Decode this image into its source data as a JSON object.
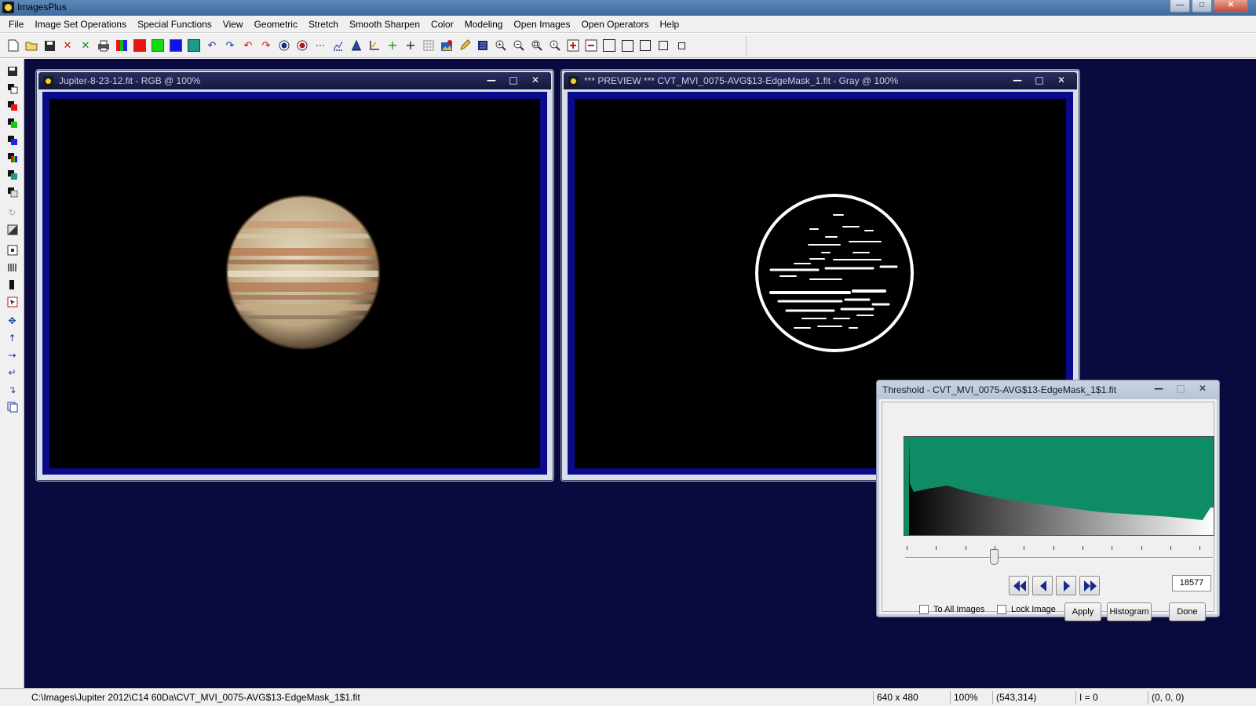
{
  "app": {
    "title": "ImagesPlus",
    "accent": "#0a0a3e"
  },
  "menu": [
    "File",
    "Image Set Operations",
    "Special Functions",
    "View",
    "Geometric",
    "Stretch",
    "Smooth Sharpen",
    "Color",
    "Modeling",
    "Open Images",
    "Open Operators",
    "Help"
  ],
  "toolbar": {
    "icons": [
      "new-file-icon",
      "open-folder-icon",
      "save-icon",
      "close-x-icon",
      "close-all-x-icon",
      "print-icon",
      "rgb-channels-icon",
      "red-channel-icon",
      "green-channel-icon",
      "blue-channel-icon",
      "grid-icon",
      "undo-icon",
      "redo-icon",
      "undo-all-icon",
      "redo-all-icon",
      "circle-mask-icon",
      "red-circle-icon",
      "dotted-line-icon",
      "plot-icon",
      "triangle-icon",
      "corner-icon",
      "plus-green-icon",
      "crosshair-icon",
      "grid-small-icon",
      "picture-edit-icon",
      "pencil-icon",
      "list-icon",
      "zoom-in-icon",
      "zoom-out-icon",
      "zoom-fit-icon",
      "zoom-actual-icon",
      "zoom-in-red-icon",
      "zoom-out-red-icon",
      "frame-large-icon",
      "frame-medium-icon",
      "frame-small-icon",
      "frame-smaller-icon",
      "frame-tiny-icon"
    ]
  },
  "windows": {
    "left": {
      "title": "Jupiter-8-23-12.fit - RGB @ 100%"
    },
    "right": {
      "title": "*** PREVIEW *** CVT_MVI_0075-AVG$13-EdgeMask_1.fit - Gray @ 100%"
    }
  },
  "threshold": {
    "title": "Threshold - CVT_MVI_0075-AVG$13-EdgeMask_1$1.fit",
    "value": "18577",
    "slider_fraction": 0.29,
    "histogram_color": "#0f8c66",
    "to_all_images": {
      "label": "To All Images",
      "checked": false
    },
    "lock_image": {
      "label": "Lock Image",
      "checked": false
    },
    "buttons": {
      "apply": "Apply",
      "histogram": "Histogram",
      "done": "Done"
    }
  },
  "status": {
    "path": "C:\\Images\\Jupiter 2012\\C14 60Da\\CVT_MVI_0075-AVG$13-EdgeMask_1$1.fit",
    "size": "640 x 480",
    "zoom": "100%",
    "coords": "(543,314)",
    "intensity": "I = 0",
    "rgb": "(0, 0, 0)"
  }
}
